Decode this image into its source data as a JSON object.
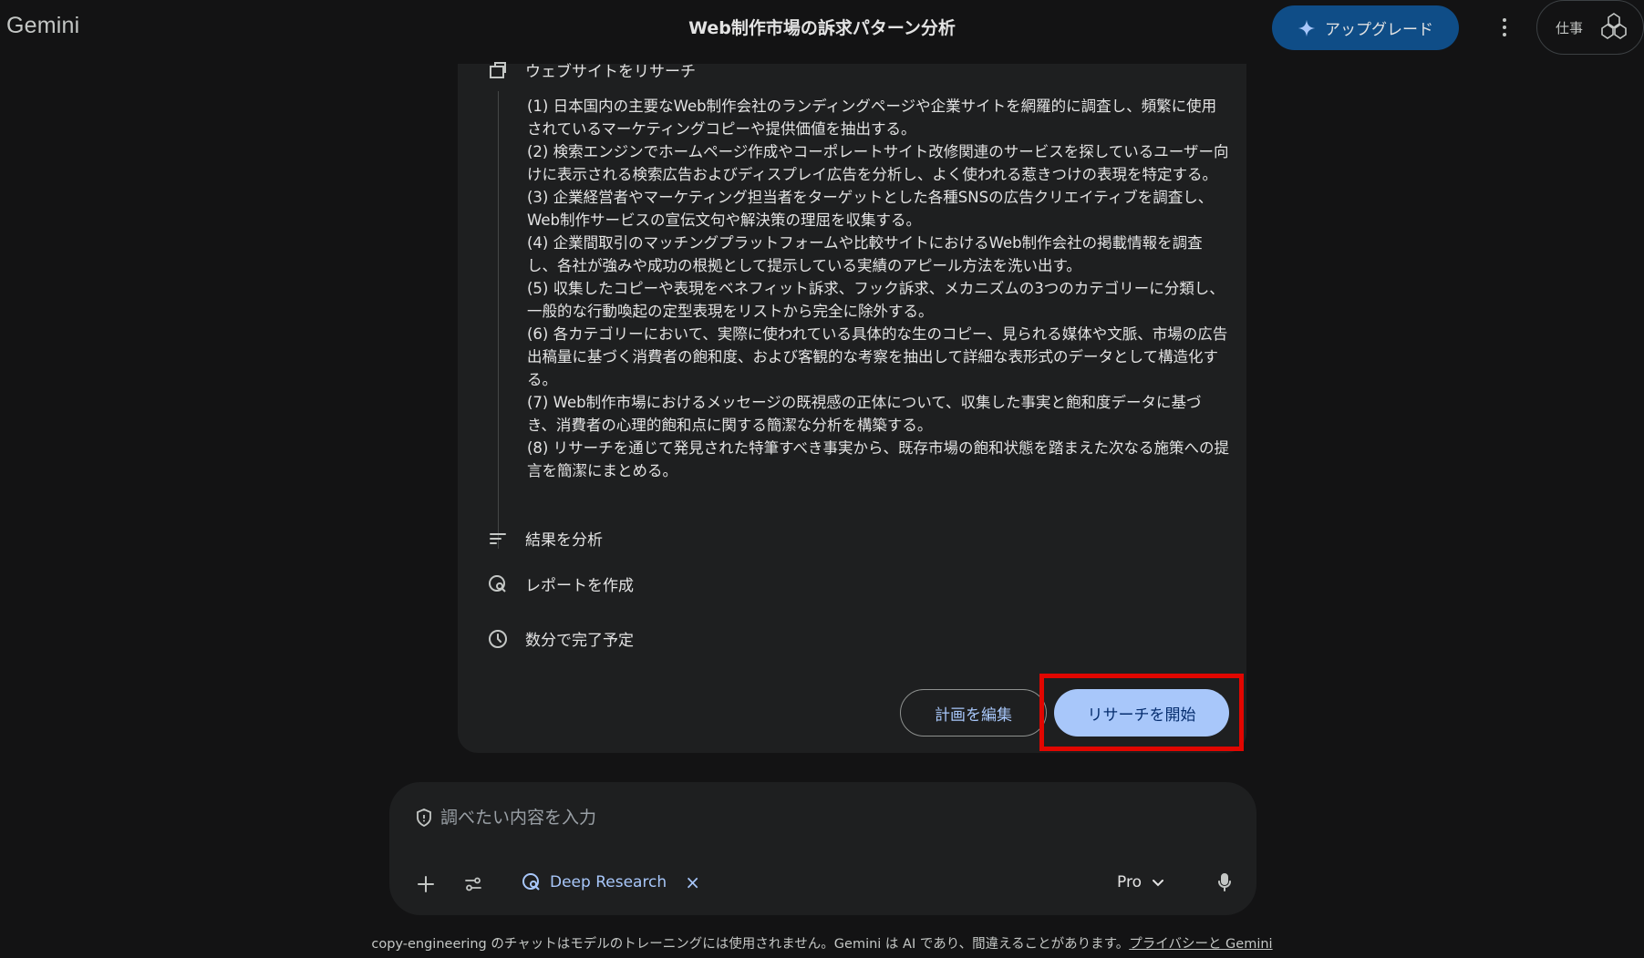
{
  "header": {
    "brand": "Gemini",
    "title": "Web制作市場の訴求パターン分析",
    "upgrade_label": "アップグレード",
    "workspace_label": "仕事"
  },
  "plan": {
    "step_research": "ウェブサイトをリサーチ",
    "items": [
      "(1) 日本国内の主要なWeb制作会社のランディングページや企業サイトを網羅的に調査し、頻繁に使用されているマーケティングコピーや提供価値を抽出する。",
      "(2) 検索エンジンでホームページ作成やコーポレートサイト改修関連のサービスを探しているユーザー向けに表示される検索広告およびディスプレイ広告を分析し、よく使われる惹きつけの表現を特定する。",
      "(3) 企業経営者やマーケティング担当者をターゲットとした各種SNSの広告クリエイティブを調査し、Web制作サービスの宣伝文句や解決策の理屈を収集する。",
      "(4) 企業間取引のマッチングプラットフォームや比較サイトにおけるWeb制作会社の掲載情報を調査し、各社が強みや成功の根拠として提示している実績のアピール方法を洗い出す。",
      "(5) 収集したコピーや表現をベネフィット訴求、フック訴求、メカニズムの3つのカテゴリーに分類し、一般的な行動喚起の定型表現をリストから完全に除外する。",
      "(6) 各カテゴリーにおいて、実際に使われている具体的な生のコピー、見られる媒体や文脈、市場の広告出稿量に基づく消費者の飽和度、および客観的な考察を抽出して詳細な表形式のデータとして構造化する。",
      "(7) Web制作市場におけるメッセージの既視感の正体について、収集した事実と飽和度データに基づき、消費者の心理的飽和点に関する簡潔な分析を構築する。",
      "(8) リサーチを通じて発見された特筆すべき事実から、既存市場の飽和状態を踏まえた次なる施策への提言を簡潔にまとめる。"
    ],
    "step_analyze": "結果を分析",
    "step_report": "レポートを作成",
    "step_eta": "数分で完了予定",
    "edit_label": "計画を編集",
    "start_label": "リサーチを開始"
  },
  "composer": {
    "placeholder": "調べたい内容を入力",
    "chip_label": "Deep Research",
    "chip_remove": "×",
    "model_label": "Pro"
  },
  "footer": {
    "text": "copy-engineering のチャットはモデルのトレーニングには使用されません。Gemini は AI であり、間違えることがあります。",
    "link": "プライバシーと Gemini"
  }
}
